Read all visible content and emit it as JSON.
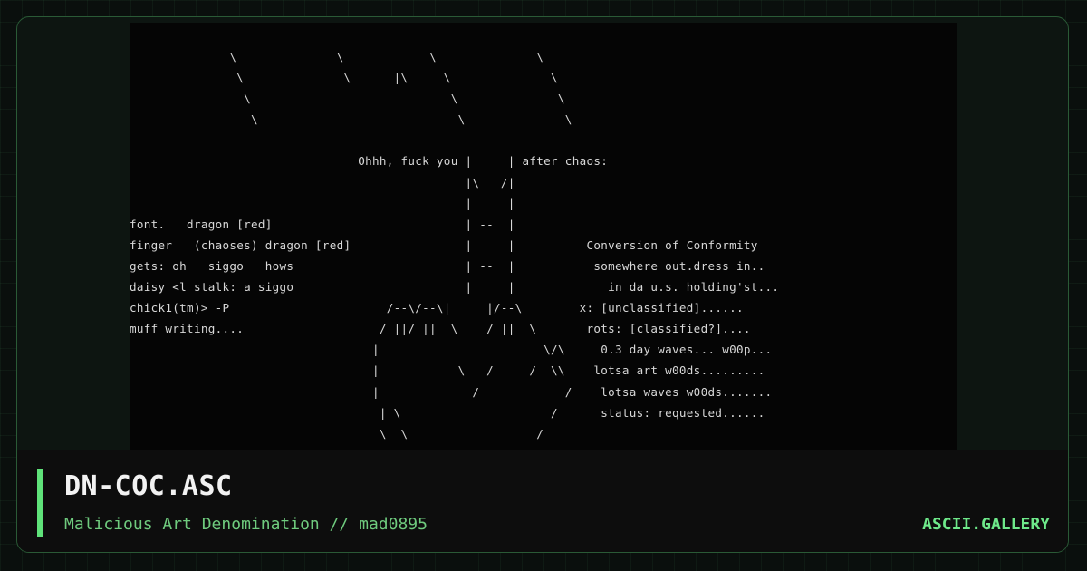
{
  "artwork": {
    "lines": [
      "              \\              \\            \\              \\",
      "               \\              \\      |\\     \\              \\",
      "                \\                            \\              \\",
      "                 \\                            \\              \\",
      "",
      "                                Ohhh, fuck you |     | after chaos:",
      "                                               |\\   /|",
      "                                               |     |",
      "font.   dragon [red]                           | --  |",
      "finger   (chaoses) dragon [red]                |     |          Conversion of Conformity",
      "gets: oh   siggo   hows                        | --  |           somewhere out.dress in..",
      "daisy <l stalk: a siggo                        |     |             in da u.s. holding'st...",
      "chick1(tm)> -P                      /--\\/--\\|     |/--\\        x: [unclassified]......",
      "muff writing....                   / ||/ ||  \\    / ||  \\       rots: [classified?]....",
      "                                  |                       \\/\\     0.3 day waves... w00p...",
      "                                  |           \\   /     /  \\\\    lotsa art w00ds.........",
      "                                  |             /            /    lotsa waves w00ds.......",
      "                                   | \\                     /      status: requested......",
      "                                   \\  \\                  /",
      "                                    )                    ("
    ]
  },
  "info": {
    "title": "DN-COC.ASC",
    "subtitle": "Malicious Art Denomination // mad0895",
    "site": "ASCII.GALLERY"
  },
  "colors": {
    "accent": "#5fe27a",
    "card_border": "#2a5a36",
    "art_background": "#050505",
    "art_text": "#d8d8d8",
    "title_text": "#f2f2f2",
    "subtitle_text": "#6fcb7e",
    "site_text": "#6ee98a"
  }
}
